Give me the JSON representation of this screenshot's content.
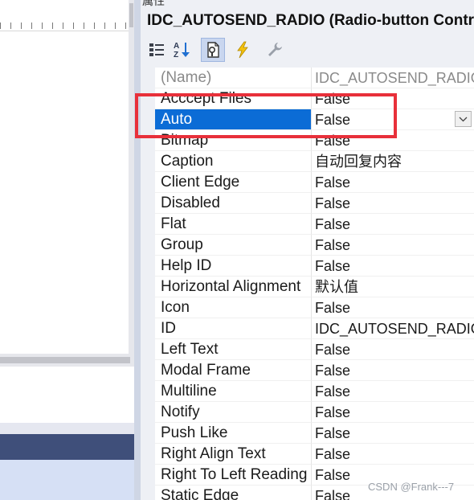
{
  "left_pane": {},
  "properties": {
    "title": "属性",
    "object_selector": "IDC_AUTOSEND_RADIO (Radio-button Control)",
    "toolbar": {
      "buttons": [
        {
          "name": "categorized-view",
          "icon": "categorized-icon",
          "active": false
        },
        {
          "name": "alphabetical-view",
          "icon": "sort-az-icon",
          "active": false
        },
        {
          "name": "properties",
          "icon": "properties-page-icon",
          "active": true
        },
        {
          "name": "control-events",
          "icon": "lightning-icon",
          "active": false
        },
        {
          "name": "property-pages",
          "icon": "wrench-icon",
          "active": false
        }
      ]
    },
    "rows": [
      {
        "name": "(Name)",
        "value": "IDC_AUTOSEND_RADIO",
        "readonly": true
      },
      {
        "name": "Acccept Files",
        "value": "False"
      },
      {
        "name": "Auto",
        "value": "False",
        "selected": true,
        "has_dropdown": true
      },
      {
        "name": "Bitmap",
        "value": "False"
      },
      {
        "name": "Caption",
        "value": "自动回复内容"
      },
      {
        "name": "Client Edge",
        "value": "False"
      },
      {
        "name": "Disabled",
        "value": "False"
      },
      {
        "name": "Flat",
        "value": "False"
      },
      {
        "name": "Group",
        "value": "False"
      },
      {
        "name": "Help ID",
        "value": "False"
      },
      {
        "name": "Horizontal Alignment",
        "value": "默认值"
      },
      {
        "name": "Icon",
        "value": "False"
      },
      {
        "name": "ID",
        "value": "IDC_AUTOSEND_RADIO"
      },
      {
        "name": "Left Text",
        "value": "False"
      },
      {
        "name": "Modal Frame",
        "value": "False"
      },
      {
        "name": "Multiline",
        "value": "False"
      },
      {
        "name": "Notify",
        "value": "False"
      },
      {
        "name": "Push Like",
        "value": "False"
      },
      {
        "name": "Right Align Text",
        "value": "False"
      },
      {
        "name": "Right To Left Reading Order",
        "value": "False"
      },
      {
        "name": "Static Edge",
        "value": "False"
      }
    ]
  },
  "watermark": "CSDN @Frank---7",
  "colors": {
    "selection": "#0b6cd6",
    "highlight_box": "#e8303a",
    "panel_bg": "#eef0f5"
  }
}
